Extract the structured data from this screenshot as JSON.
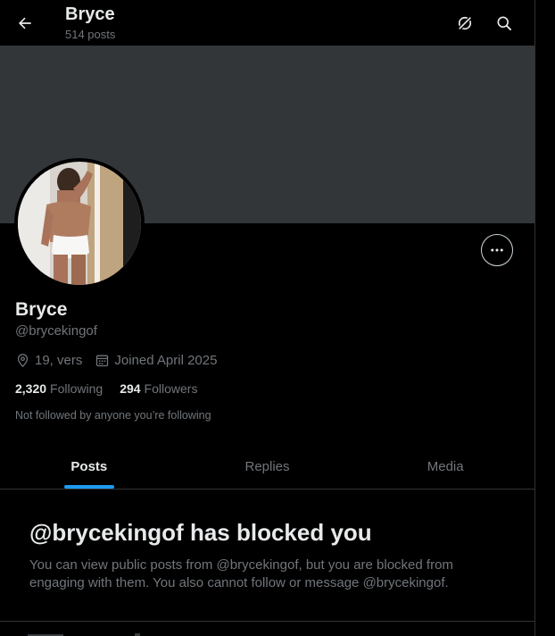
{
  "header": {
    "title": "Bryce",
    "post_count": "514 posts"
  },
  "profile": {
    "name": "Bryce",
    "handle": "@brycekingof",
    "location": "19, vers",
    "joined": "Joined April 2025",
    "following_count": "2,320",
    "following_label": "Following",
    "followers_count": "294",
    "followers_label": "Followers",
    "not_followed_text": "Not followed by anyone you’re following"
  },
  "tabs": [
    {
      "label": "Posts",
      "active": true
    },
    {
      "label": "Replies",
      "active": false
    },
    {
      "label": "Media",
      "active": false
    }
  ],
  "blocked": {
    "title": "@brycekingof has blocked you",
    "message": "You can view public posts from @brycekingof, but you are blocked from engaging with them. You also cannot follow or message @brycekingof."
  },
  "icons": {
    "back": "arrow-left-icon",
    "grok": "grok-icon",
    "search": "search-icon",
    "more": "more-horizontal-icon",
    "location": "location-pin-icon",
    "calendar": "calendar-icon"
  },
  "colors": {
    "background": "#000000",
    "banner": "#333639",
    "accent": "#1d9bf0",
    "text_primary": "#e7e9ea",
    "text_secondary": "#71767b",
    "border": "#2f3336"
  }
}
